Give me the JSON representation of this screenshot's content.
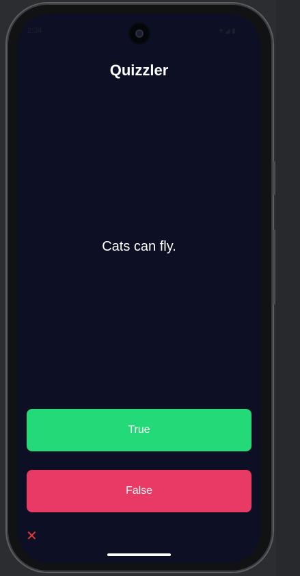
{
  "status_bar": {
    "time": "2:34"
  },
  "app": {
    "title": "Quizzler"
  },
  "quiz": {
    "question": "Cats can fly.",
    "true_label": "True",
    "false_label": "False"
  },
  "score_keeper": [
    {
      "icon": "close-icon",
      "symbol": "✕",
      "color": "#e53935"
    }
  ],
  "colors": {
    "background": "#0d1024",
    "true_button": "#24d977",
    "false_button": "#e83a65",
    "wrong_mark": "#e53935"
  }
}
